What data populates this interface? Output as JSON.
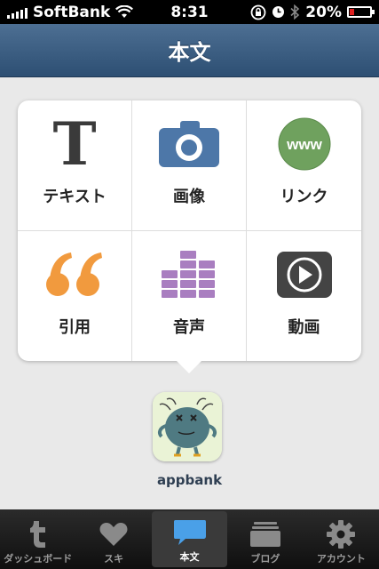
{
  "status_bar": {
    "carrier": "SoftBank",
    "time": "8:31",
    "battery": "20%",
    "battery_level": 0.2
  },
  "nav": {
    "title": "本文"
  },
  "grid": {
    "items": [
      {
        "label": "テキスト",
        "icon": "text-icon"
      },
      {
        "label": "画像",
        "icon": "camera-icon"
      },
      {
        "label": "リンク",
        "icon": "www-icon"
      },
      {
        "label": "引用",
        "icon": "quote-icon"
      },
      {
        "label": "音声",
        "icon": "audio-bars-icon"
      },
      {
        "label": "動画",
        "icon": "video-play-icon"
      }
    ],
    "text_icon_glyph": "T",
    "www_text": "www"
  },
  "account": {
    "name": "appbank"
  },
  "tab_bar": {
    "tabs": [
      {
        "label": "ダッシュボード",
        "icon": "tumblr-t-icon"
      },
      {
        "label": "スキ",
        "icon": "heart-icon"
      },
      {
        "label": "本文",
        "icon": "compose-bubble-icon",
        "active": true
      },
      {
        "label": "ブログ",
        "icon": "folder-stack-icon"
      },
      {
        "label": "アカウント",
        "icon": "gear-icon"
      }
    ]
  },
  "colors": {
    "nav_bg": "#3b5d82",
    "camera": "#4d77a8",
    "www": "#6fa15e",
    "quote": "#f19a3e",
    "audio": "#a97ec0",
    "video": "#444444"
  }
}
